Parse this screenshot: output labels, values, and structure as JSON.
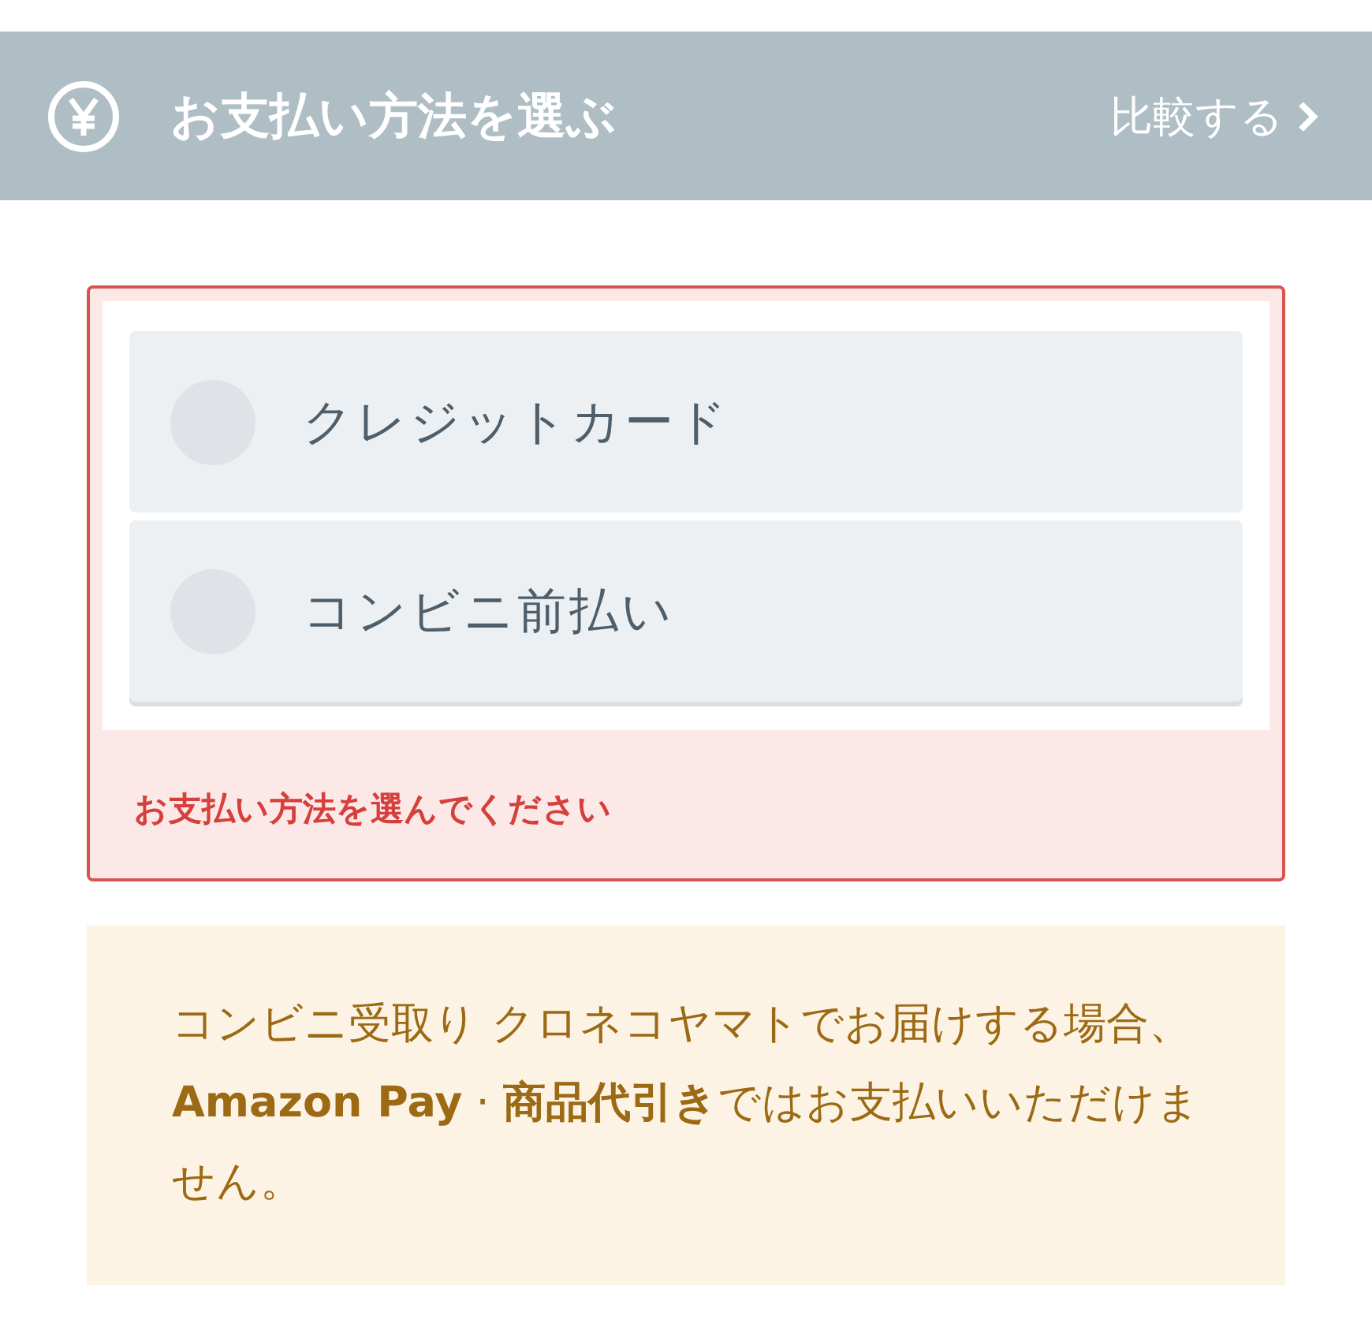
{
  "header": {
    "title": "お支払い方法を選ぶ",
    "compare_link": "比較する"
  },
  "payment_options": [
    {
      "label": "クレジットカード",
      "selected": false
    },
    {
      "label": "コンビニ前払い",
      "selected": false
    }
  ],
  "error_message": "お支払い方法を選んでください",
  "notice": "コンビニ受取り クロネコヤマトでお届けする場合、**Amazon Pay** · **商品代引き**ではお支払いいただけません。"
}
